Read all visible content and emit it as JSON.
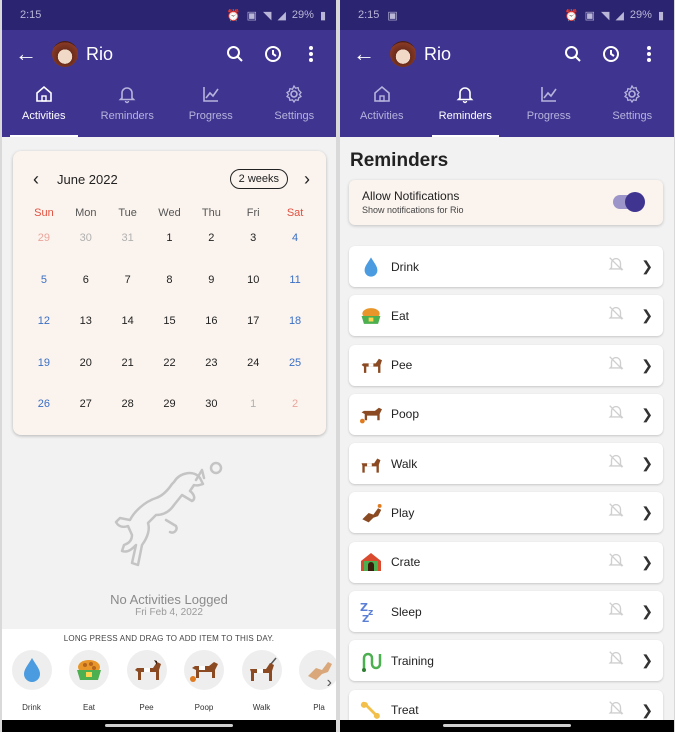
{
  "status": {
    "time": "2:15",
    "battery": "29%"
  },
  "appbar": {
    "pet_name": "Rio"
  },
  "tabs": [
    {
      "label": "Activities",
      "icon": "home-icon"
    },
    {
      "label": "Reminders",
      "icon": "bell-icon"
    },
    {
      "label": "Progress",
      "icon": "chart-icon"
    },
    {
      "label": "Settings",
      "icon": "gear-icon"
    }
  ],
  "calendar": {
    "month_label": "June 2022",
    "range_pill": "2 weeks",
    "weekdays": [
      "Sun",
      "Mon",
      "Tue",
      "Wed",
      "Thu",
      "Fri",
      "Sat"
    ],
    "weeks": [
      [
        "29",
        "30",
        "31",
        "1",
        "2",
        "3",
        "4"
      ],
      [
        "5",
        "6",
        "7",
        "8",
        "9",
        "10",
        "11"
      ],
      [
        "12",
        "13",
        "14",
        "15",
        "16",
        "17",
        "18"
      ],
      [
        "19",
        "20",
        "21",
        "22",
        "23",
        "24",
        "25"
      ],
      [
        "26",
        "27",
        "28",
        "29",
        "30",
        "1",
        "2"
      ]
    ]
  },
  "empty_state": {
    "title": "No Activities Logged",
    "date": "Fri Feb 4, 2022"
  },
  "tray": {
    "hint": "LONG PRESS AND DRAG TO ADD ITEM TO THIS DAY.",
    "items": [
      "Drink",
      "Eat",
      "Pee",
      "Poop",
      "Walk",
      "Pla"
    ]
  },
  "reminders": {
    "title": "Reminders",
    "allow_title": "Allow Notifications",
    "allow_sub": "Show notifications for Rio",
    "allow_enabled": true,
    "items": [
      "Drink",
      "Eat",
      "Pee",
      "Poop",
      "Walk",
      "Play",
      "Crate",
      "Sleep",
      "Training",
      "Treat"
    ]
  },
  "colors": {
    "primary": "#3f3591",
    "status_bar": "#2b2470",
    "card_bg": "#fbf4ee",
    "weekend_red": "#e0503f",
    "sunday_blue": "#3a6fc4"
  }
}
